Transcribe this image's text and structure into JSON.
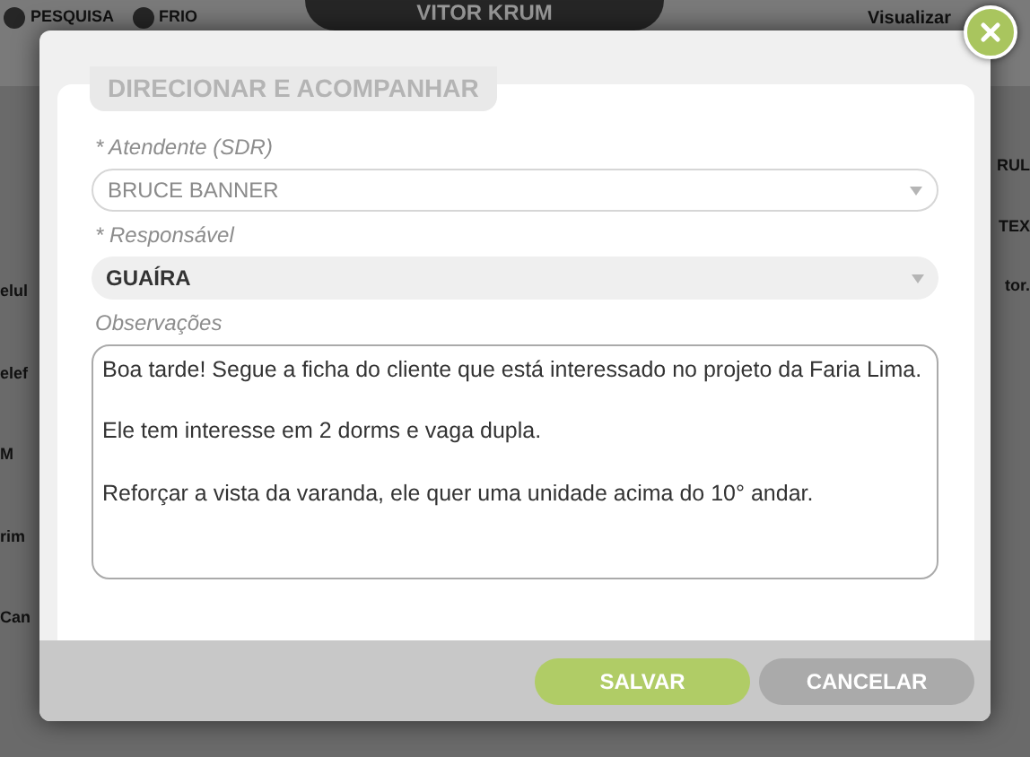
{
  "background": {
    "header": [
      {
        "kind": "status",
        "label": "PESQUISA"
      },
      {
        "kind": "status",
        "label": "FRIO"
      },
      {
        "kind": "name",
        "label": "VITOR KRUM"
      },
      {
        "kind": "action",
        "label": "Visualizar"
      }
    ],
    "left_labels": [
      "elul",
      "elef",
      "M",
      "rim",
      "Can"
    ],
    "right_labels": [
      "RUL",
      "TEX",
      "tor."
    ]
  },
  "dialog": {
    "title": "DIRECIONAR E ACOMPANHAR",
    "fields": [
      {
        "kind": "select",
        "label": "* Atendente (SDR)",
        "value": "BRUCE BANNER",
        "disabled": true
      },
      {
        "kind": "select",
        "label": "* Responsável",
        "value": "GUAÍRA",
        "disabled": false
      },
      {
        "kind": "textarea",
        "label": "Observações",
        "value": "Boa tarde! Segue a ficha do cliente que está interessado no projeto da Faria Lima.\n\nEle tem interesse em 2 dorms e vaga dupla.\n\nReforçar a vista da varanda, ele quer uma unidade acima do 10° andar."
      }
    ],
    "buttons": [
      {
        "kind": "primary",
        "label": "SALVAR"
      },
      {
        "kind": "secondary",
        "label": "CANCELAR"
      }
    ]
  }
}
